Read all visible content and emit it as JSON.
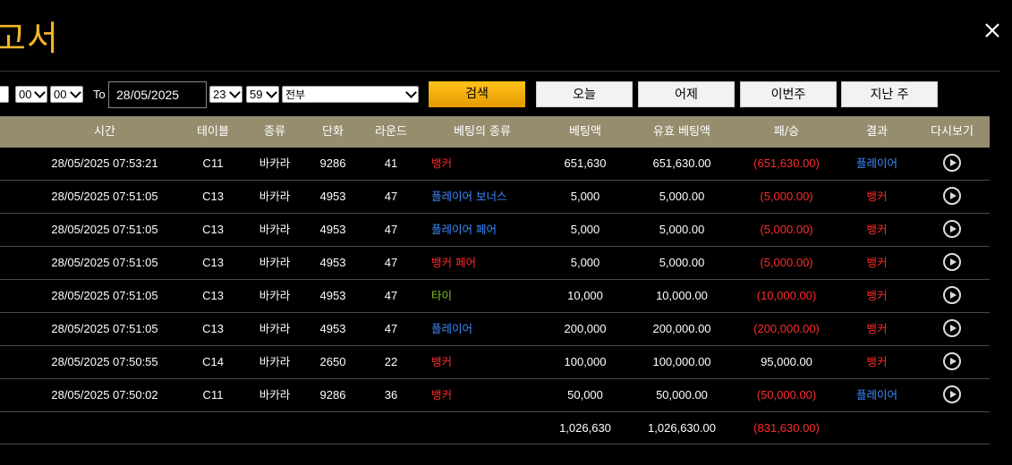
{
  "page": {
    "title": "고서"
  },
  "filters": {
    "from_hour": "00",
    "from_minute": "00",
    "to_label": "To",
    "to_date": "28/05/2025",
    "to_hour": "23",
    "to_minute": "59",
    "game_type": "전부",
    "search_label": "검색",
    "today_label": "오늘",
    "yesterday_label": "어제",
    "this_week_label": "이번주",
    "last_week_label": "지난 주"
  },
  "table": {
    "headers": [
      "시간",
      "테이블",
      "종류",
      "단화",
      "라운드",
      "베팅의 종류",
      "베팅액",
      "유효 베팅액",
      "패/승",
      "결과",
      "다시보기"
    ],
    "rows": [
      {
        "time": "28/05/2025 07:53:21",
        "table": "C11",
        "kind": "바카라",
        "shoe": "9286",
        "round": "41",
        "bet_type": "뱅커",
        "bet_color": "red",
        "amount": "651,630",
        "valid": "651,630.00",
        "winloss": "(651,630.00)",
        "winloss_color": "red",
        "result": "플레이어",
        "result_color": "blue"
      },
      {
        "time": "28/05/2025 07:51:05",
        "table": "C13",
        "kind": "바카라",
        "shoe": "4953",
        "round": "47",
        "bet_type": "플레이어 보너스",
        "bet_color": "blue",
        "amount": "5,000",
        "valid": "5,000.00",
        "winloss": "(5,000.00)",
        "winloss_color": "red",
        "result": "뱅커",
        "result_color": "red"
      },
      {
        "time": "28/05/2025 07:51:05",
        "table": "C13",
        "kind": "바카라",
        "shoe": "4953",
        "round": "47",
        "bet_type": "플레이어 페어",
        "bet_color": "blue",
        "amount": "5,000",
        "valid": "5,000.00",
        "winloss": "(5,000.00)",
        "winloss_color": "red",
        "result": "뱅커",
        "result_color": "red"
      },
      {
        "time": "28/05/2025 07:51:05",
        "table": "C13",
        "kind": "바카라",
        "shoe": "4953",
        "round": "47",
        "bet_type": "뱅커 페어",
        "bet_color": "red",
        "amount": "5,000",
        "valid": "5,000.00",
        "winloss": "(5,000.00)",
        "winloss_color": "red",
        "result": "뱅커",
        "result_color": "red"
      },
      {
        "time": "28/05/2025 07:51:05",
        "table": "C13",
        "kind": "바카라",
        "shoe": "4953",
        "round": "47",
        "bet_type": "타이",
        "bet_color": "green",
        "amount": "10,000",
        "valid": "10,000.00",
        "winloss": "(10,000.00)",
        "winloss_color": "red",
        "result": "뱅커",
        "result_color": "red"
      },
      {
        "time": "28/05/2025 07:51:05",
        "table": "C13",
        "kind": "바카라",
        "shoe": "4953",
        "round": "47",
        "bet_type": "플레이어",
        "bet_color": "blue",
        "amount": "200,000",
        "valid": "200,000.00",
        "winloss": "(200,000.00)",
        "winloss_color": "red",
        "result": "뱅커",
        "result_color": "red"
      },
      {
        "time": "28/05/2025 07:50:55",
        "table": "C14",
        "kind": "바카라",
        "shoe": "2650",
        "round": "22",
        "bet_type": "뱅커",
        "bet_color": "red",
        "amount": "100,000",
        "valid": "100,000.00",
        "winloss": "95,000.00",
        "winloss_color": "white",
        "result": "뱅커",
        "result_color": "red"
      },
      {
        "time": "28/05/2025 07:50:02",
        "table": "C11",
        "kind": "바카라",
        "shoe": "9286",
        "round": "36",
        "bet_type": "뱅커",
        "bet_color": "red",
        "amount": "50,000",
        "valid": "50,000.00",
        "winloss": "(50,000.00)",
        "winloss_color": "red",
        "result": "플레이어",
        "result_color": "blue"
      }
    ],
    "totals": {
      "amount": "1,026,630",
      "valid": "1,026,630.00",
      "winloss": "(831,630.00)"
    }
  },
  "colors": {
    "accent": "#f3b52b",
    "header_bg": "#968d6f",
    "red": "#ff2a2a",
    "blue": "#3d8bff",
    "green": "#7ec826"
  }
}
